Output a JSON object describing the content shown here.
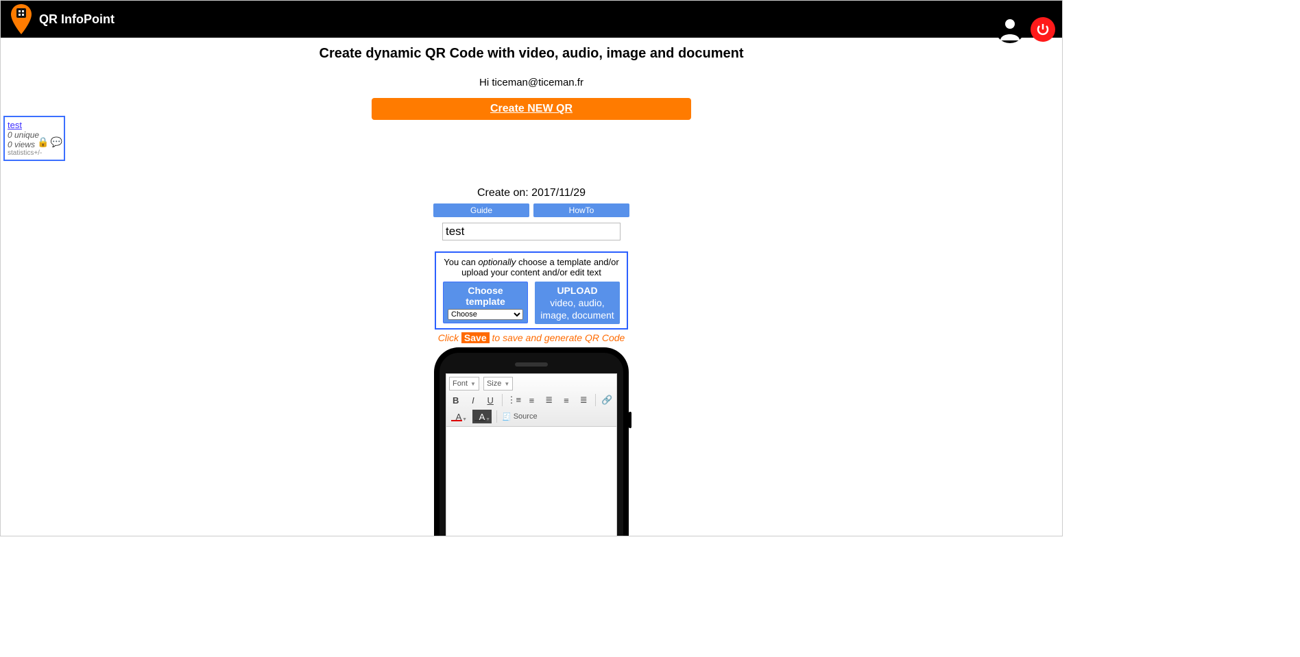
{
  "header": {
    "brand": "QR InfoPoint"
  },
  "headline": "Create dynamic QR Code with video, audio, image and document",
  "greeting": "Hi ticeman@ticeman.fr",
  "create_new": "Create NEW QR",
  "side": {
    "title": "test",
    "unique": "0 unique",
    "views": "0 views",
    "stats": "statistics+/-"
  },
  "created_on_label": "Create on:",
  "created_on_date": "2017/11/29",
  "tabs": {
    "guide": "Guide",
    "howto": "HowTo"
  },
  "title_value": "test",
  "opt": {
    "prefix": "You can ",
    "optionally": "optionally",
    "suffix": " choose a template and/or upload your content and/or edit text",
    "choose_label": "Choose template",
    "select": "Choose",
    "upload_big": "UPLOAD",
    "upload_rest": "video, audio, image, document"
  },
  "click_save": {
    "pre": "Click ",
    "save": "Save",
    "post": " to save and generate QR Code"
  },
  "editor": {
    "font": "Font",
    "size": "Size",
    "source": "Source"
  }
}
